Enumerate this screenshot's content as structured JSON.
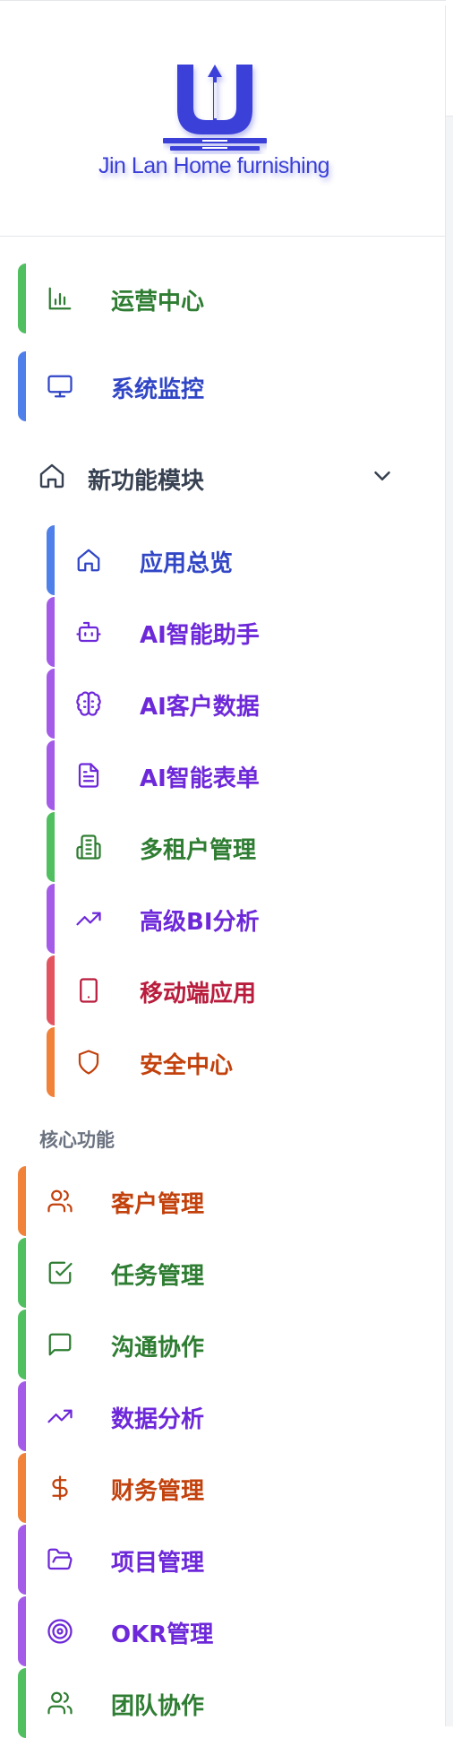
{
  "logo": {
    "text": "Jin Lan Home furnishing"
  },
  "colors": {
    "green": "#4fbf5f",
    "green_text": "#2e7d32",
    "blue": "#4f7fe8",
    "blue_text": "#3146c6",
    "purple": "#a45ce8",
    "purple_text": "#6d28d9",
    "red": "#e25560",
    "red_text": "#b91c3c",
    "orange": "#f0823a",
    "orange_text": "#c2410c"
  },
  "nav": {
    "top": [
      {
        "label": "运营中心",
        "icon": "bar-chart-icon"
      },
      {
        "label": "系统监控",
        "icon": "monitor-icon"
      }
    ],
    "group": {
      "label": "新功能模块",
      "icon": "home-icon",
      "expanded": true
    },
    "sub": [
      {
        "label": "应用总览",
        "icon": "home-icon"
      },
      {
        "label": "AI智能助手",
        "icon": "bot-icon"
      },
      {
        "label": "AI客户数据",
        "icon": "brain-icon"
      },
      {
        "label": "AI智能表单",
        "icon": "file-text-icon"
      },
      {
        "label": "多租户管理",
        "icon": "building-icon"
      },
      {
        "label": "高级BI分析",
        "icon": "trending-up-icon"
      },
      {
        "label": "移动端应用",
        "icon": "smartphone-icon"
      },
      {
        "label": "安全中心",
        "icon": "shield-icon"
      }
    ],
    "section_title": "核心功能",
    "core": [
      {
        "label": "客户管理",
        "icon": "users-icon"
      },
      {
        "label": "任务管理",
        "icon": "check-square-icon"
      },
      {
        "label": "沟通协作",
        "icon": "message-square-icon"
      },
      {
        "label": "数据分析",
        "icon": "trending-up-icon"
      },
      {
        "label": "财务管理",
        "icon": "dollar-icon"
      },
      {
        "label": "项目管理",
        "icon": "folder-open-icon"
      },
      {
        "label": "OKR管理",
        "icon": "target-icon"
      },
      {
        "label": "团队协作",
        "icon": "users-icon"
      }
    ]
  }
}
